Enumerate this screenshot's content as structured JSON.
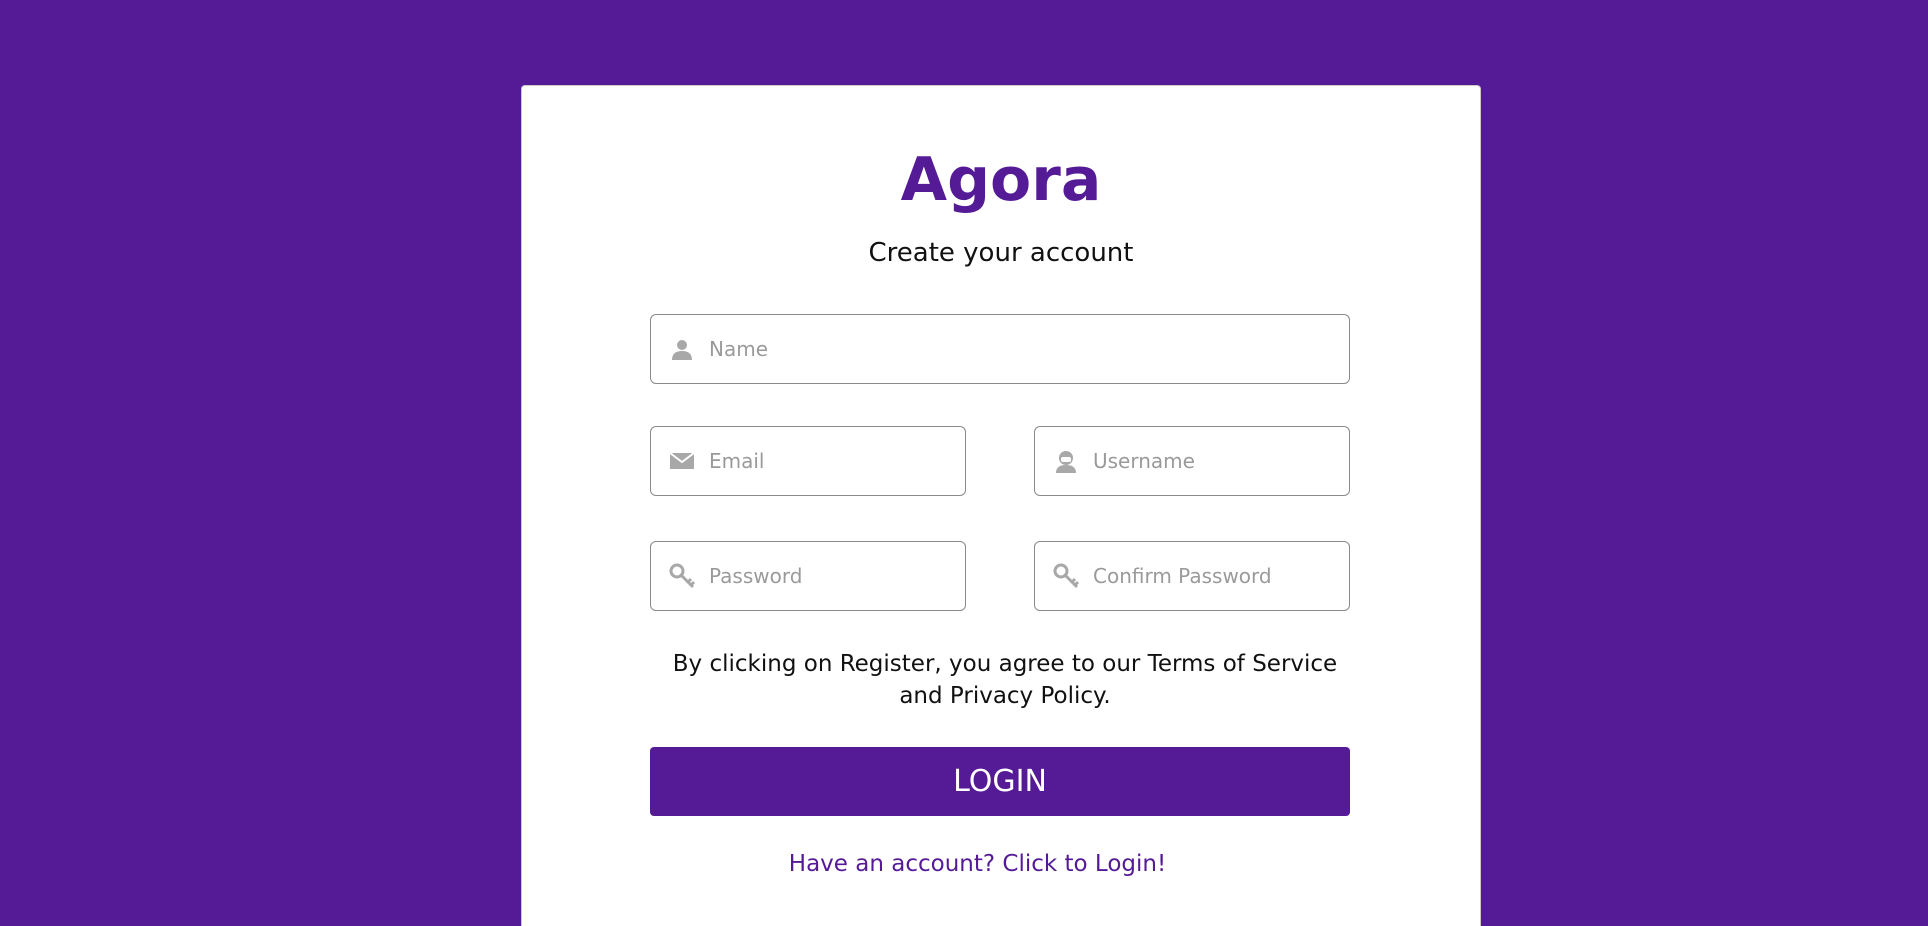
{
  "colors": {
    "background": "#551a96",
    "accent": "#551a96",
    "card": "#ffffff",
    "icon": "#a8a8a8"
  },
  "brand": {
    "title": "Agora"
  },
  "form": {
    "subtitle": "Create your account",
    "fields": {
      "name": {
        "placeholder": "Name",
        "value": "",
        "icon": "user-icon"
      },
      "email": {
        "placeholder": "Email",
        "value": "",
        "icon": "envelope-icon"
      },
      "username": {
        "placeholder": "Username",
        "value": "",
        "icon": "user-circle-icon"
      },
      "password": {
        "placeholder": "Password",
        "value": "",
        "icon": "key-icon"
      },
      "confirm_password": {
        "placeholder": "Confirm Password",
        "value": "",
        "icon": "key-icon"
      }
    },
    "terms_text": "By clicking on Register, you agree to our Terms of Service and Privacy Policy.",
    "submit_label": "LOGIN",
    "login_link": "Have an account? Click to Login!"
  }
}
